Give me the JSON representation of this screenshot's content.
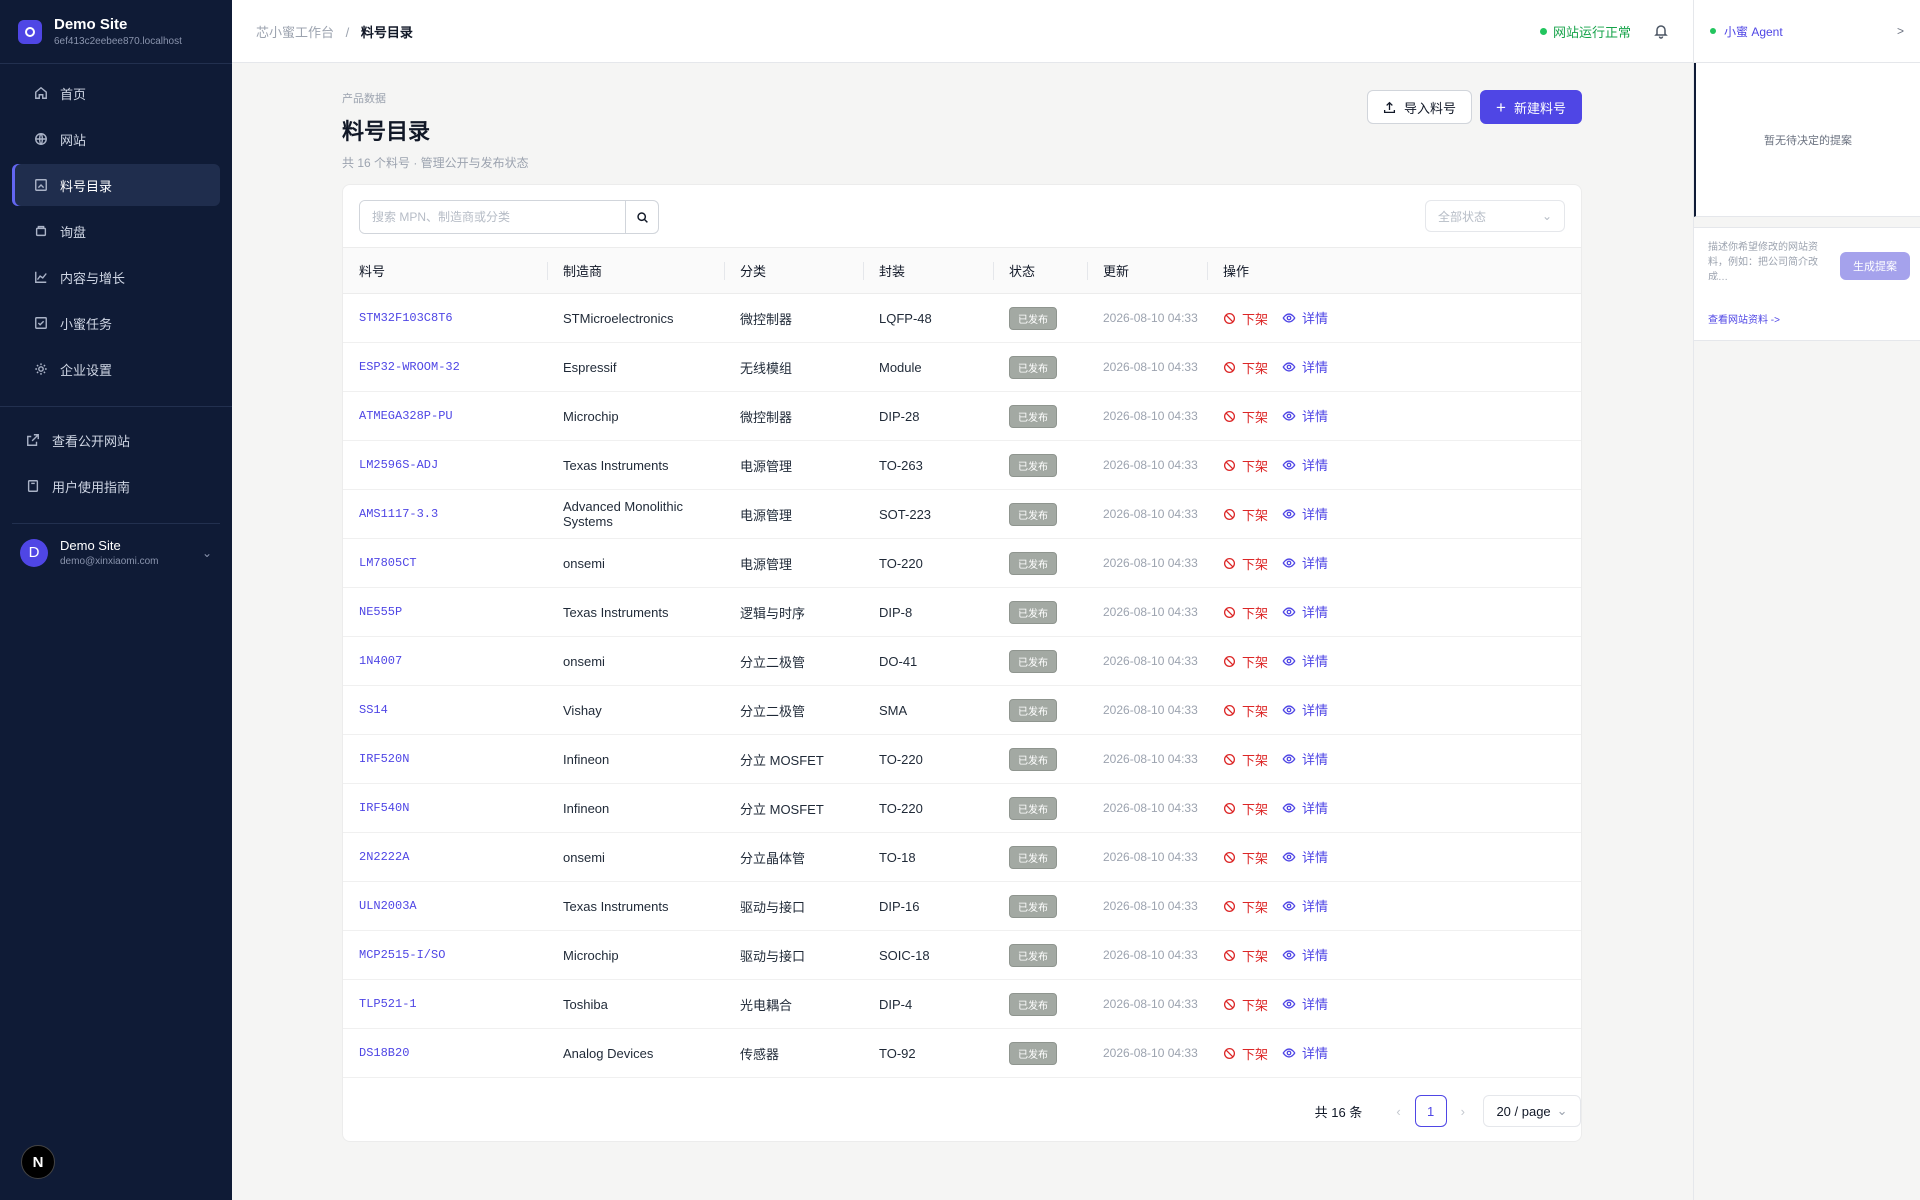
{
  "site": {
    "name": "Demo Site",
    "host": "6ef413c2eebee870.localhost"
  },
  "sidebar": {
    "items": [
      {
        "label": "首页",
        "icon": "home-icon"
      },
      {
        "label": "网站",
        "icon": "globe-icon"
      },
      {
        "label": "料号目录",
        "icon": "catalog-icon",
        "active": true
      },
      {
        "label": "询盘",
        "icon": "inbox-icon"
      },
      {
        "label": "内容与增长",
        "icon": "chart-icon"
      },
      {
        "label": "小蜜任务",
        "icon": "task-icon"
      },
      {
        "label": "企业设置",
        "icon": "gear-icon"
      }
    ],
    "links": [
      {
        "label": "查看公开网站",
        "icon": "external-link-icon"
      },
      {
        "label": "用户使用指南",
        "icon": "book-icon"
      }
    ]
  },
  "user": {
    "initial": "D",
    "name": "Demo Site",
    "email": "demo@xinxiaomi.com"
  },
  "n_badge": "N",
  "topbar": {
    "breadcrumb_root": "芯小蜜工作台",
    "breadcrumb_sep": "/",
    "breadcrumb_current": "料号目录",
    "status": "网站运行正常"
  },
  "page": {
    "eyebrow": "产品数据",
    "title": "料号目录",
    "subtitle": "共 16 个料号 · 管理公开与发布状态",
    "import_label": "导入料号",
    "new_label": "新建料号"
  },
  "search": {
    "placeholder": "搜索 MPN、制造商或分类"
  },
  "filter": {
    "placeholder": "全部状态"
  },
  "table": {
    "headers": [
      "料号",
      "制造商",
      "分类",
      "封装",
      "状态",
      "更新",
      "操作"
    ],
    "op_unpublish": "下架",
    "op_detail": "详情",
    "rows": [
      {
        "mpn": "STM32F103C8T6",
        "maker": "STMicroelectronics",
        "category": "微控制器",
        "package": "LQFP-48",
        "status": "已发布",
        "updated": "2026-08-10 04:33"
      },
      {
        "mpn": "ESP32-WROOM-32",
        "maker": "Espressif",
        "category": "无线模组",
        "package": "Module",
        "status": "已发布",
        "updated": "2026-08-10 04:33"
      },
      {
        "mpn": "ATMEGA328P-PU",
        "maker": "Microchip",
        "category": "微控制器",
        "package": "DIP-28",
        "status": "已发布",
        "updated": "2026-08-10 04:33"
      },
      {
        "mpn": "LM2596S-ADJ",
        "maker": "Texas Instruments",
        "category": "电源管理",
        "package": "TO-263",
        "status": "已发布",
        "updated": "2026-08-10 04:33"
      },
      {
        "mpn": "AMS1117-3.3",
        "maker": "Advanced Monolithic Systems",
        "category": "电源管理",
        "package": "SOT-223",
        "status": "已发布",
        "updated": "2026-08-10 04:33"
      },
      {
        "mpn": "LM7805CT",
        "maker": "onsemi",
        "category": "电源管理",
        "package": "TO-220",
        "status": "已发布",
        "updated": "2026-08-10 04:33"
      },
      {
        "mpn": "NE555P",
        "maker": "Texas Instruments",
        "category": "逻辑与时序",
        "package": "DIP-8",
        "status": "已发布",
        "updated": "2026-08-10 04:33"
      },
      {
        "mpn": "1N4007",
        "maker": "onsemi",
        "category": "分立二极管",
        "package": "DO-41",
        "status": "已发布",
        "updated": "2026-08-10 04:33"
      },
      {
        "mpn": "SS14",
        "maker": "Vishay",
        "category": "分立二极管",
        "package": "SMA",
        "status": "已发布",
        "updated": "2026-08-10 04:33"
      },
      {
        "mpn": "IRF520N",
        "maker": "Infineon",
        "category": "分立 MOSFET",
        "package": "TO-220",
        "status": "已发布",
        "updated": "2026-08-10 04:33"
      },
      {
        "mpn": "IRF540N",
        "maker": "Infineon",
        "category": "分立 MOSFET",
        "package": "TO-220",
        "status": "已发布",
        "updated": "2026-08-10 04:33"
      },
      {
        "mpn": "2N2222A",
        "maker": "onsemi",
        "category": "分立晶体管",
        "package": "TO-18",
        "status": "已发布",
        "updated": "2026-08-10 04:33"
      },
      {
        "mpn": "ULN2003A",
        "maker": "Texas Instruments",
        "category": "驱动与接口",
        "package": "DIP-16",
        "status": "已发布",
        "updated": "2026-08-10 04:33"
      },
      {
        "mpn": "MCP2515-I/SO",
        "maker": "Microchip",
        "category": "驱动与接口",
        "package": "SOIC-18",
        "status": "已发布",
        "updated": "2026-08-10 04:33"
      },
      {
        "mpn": "TLP521-1",
        "maker": "Toshiba",
        "category": "光电耦合",
        "package": "DIP-4",
        "status": "已发布",
        "updated": "2026-08-10 04:33"
      },
      {
        "mpn": "DS18B20",
        "maker": "Analog Devices",
        "category": "传感器",
        "package": "TO-92",
        "status": "已发布",
        "updated": "2026-08-10 04:33"
      }
    ]
  },
  "pager": {
    "total": "共 16 条",
    "prev": "‹",
    "page": "1",
    "next": "›",
    "size": "20 / page"
  },
  "agent": {
    "title": "小蜜 Agent",
    "close": ">",
    "empty": "暂无待决定的提案",
    "input_placeholder": "描述你希望修改的网站资料，例如：把公司简介改成…",
    "generate": "生成提案",
    "link": "查看网站资料 ->"
  },
  "colors": {
    "sidebar_bg": "#0f1b36",
    "accent": "#4f46e5",
    "danger": "#dc2626",
    "ok": "#22c55e"
  }
}
